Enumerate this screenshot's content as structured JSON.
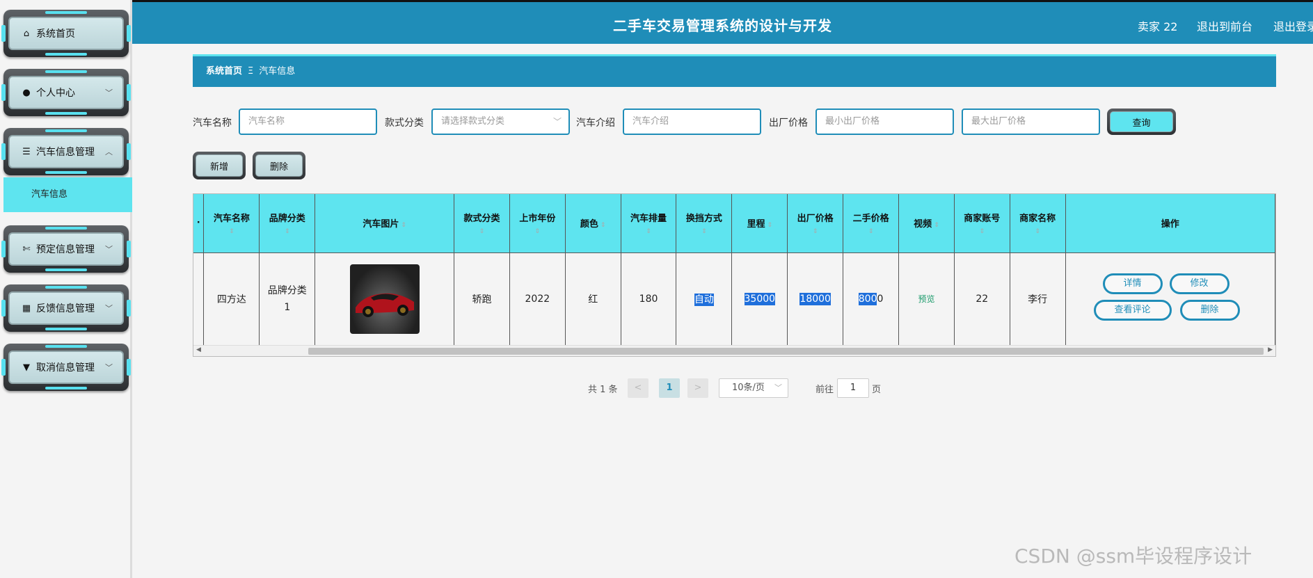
{
  "header": {
    "title": "二手车交易管理系统的设计与开发",
    "user": "卖家 22",
    "back_link": "退出到前台",
    "logout_link": "退出登录"
  },
  "sidebar": {
    "items": [
      {
        "label": "系统首页",
        "icon": "home-icon"
      },
      {
        "label": "个人中心",
        "icon": "user-icon"
      },
      {
        "label": "汽车信息管理",
        "icon": "list-icon"
      },
      {
        "label": "预定信息管理",
        "icon": "ticket-icon"
      },
      {
        "label": "反馈信息管理",
        "icon": "grid-icon"
      },
      {
        "label": "取消信息管理",
        "icon": "sign-icon"
      }
    ],
    "submenu_item": "汽车信息"
  },
  "breadcrumb": {
    "home": "系统首页",
    "separator": "Ξ",
    "current": "汽车信息"
  },
  "search": {
    "name_label": "汽车名称",
    "name_placeholder": "汽车名称",
    "style_label": "款式分类",
    "style_placeholder": "请选择款式分类",
    "intro_label": "汽车介绍",
    "intro_placeholder": "汽车介绍",
    "price_label": "出厂价格",
    "min_price_placeholder": "最小出厂价格",
    "max_price_placeholder": "最大出厂价格",
    "query_button": "查询"
  },
  "toolbar": {
    "add_button": "新增",
    "delete_button": "删除"
  },
  "table": {
    "columns": [
      "汽车名称",
      "品牌分类",
      "汽车图片",
      "款式分类",
      "上市年份",
      "颜色",
      "汽车排量",
      "换挡方式",
      "里程",
      "出厂价格",
      "二手价格",
      "视频",
      "商家账号",
      "商家名称",
      "操作"
    ],
    "rows": [
      {
        "name": "四方达",
        "brand": "品牌分类1",
        "style": "轿跑",
        "year": "2022",
        "color": "红",
        "displacement": "180",
        "transmission": "自动",
        "mileage": "35000",
        "factory_price": "18000",
        "used_price_hl": "800",
        "used_price_rest": "0",
        "video": "预览",
        "merchant_account": "22",
        "merchant_name": "李行",
        "actions": {
          "detail": "详情",
          "edit": "修改",
          "reviews": "查看评论",
          "delete": "删除"
        }
      }
    ]
  },
  "pagination": {
    "total": "共 1 条",
    "prev": "<",
    "current_page": "1",
    "next": ">",
    "page_size": "10条/页",
    "goto_label": "前往",
    "goto_value": "1",
    "page_unit": "页"
  },
  "watermark": "CSDN @ssm毕设程序设计",
  "colors": {
    "primary": "#1f8db8",
    "accent": "#5ee4ef",
    "highlight": "#1f6fdb"
  }
}
